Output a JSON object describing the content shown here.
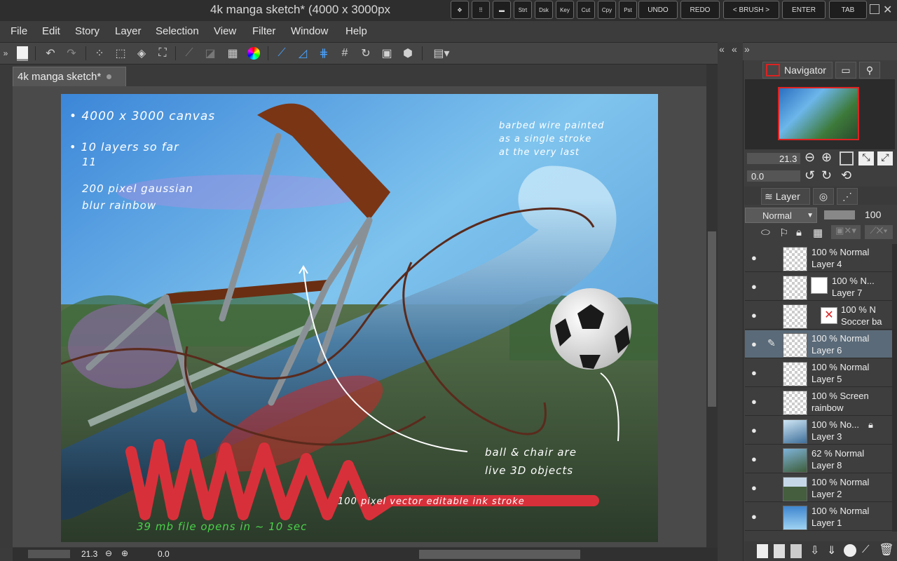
{
  "window": {
    "title": "4k manga sketch* (4000 x 3000px",
    "buttons": [
      "Strt",
      "Dsk",
      "Key",
      "Cut",
      "Cpy",
      "Pst",
      "UNDO",
      "REDO",
      "< BRUSH >",
      "ENTER",
      "TAB"
    ]
  },
  "menu": [
    "File",
    "Edit",
    "Story",
    "Layer",
    "Selection",
    "View",
    "Filter",
    "Window",
    "Help"
  ],
  "document_tab": {
    "label": "4k manga sketch*"
  },
  "canvas_notes": [
    "• 4000 x 3000  canvas",
    "• 10 layers  so far",
    "11",
    "200 pixel gaussian",
    "blur rainbow",
    "barbed wire painted",
    "as a single stroke",
    "at the very last",
    "ball & chair are",
    "live 3D objects",
    "100 pixel vector editable ink stroke",
    "39 mb file opens in ~ 10 sec"
  ],
  "status": {
    "zoom": "21.3",
    "rotation": "0.0"
  },
  "navigator": {
    "tabs": [
      "Navigator"
    ],
    "zoom": "21.3",
    "rotation": "0.0"
  },
  "layer_panel": {
    "tab_label": "Layer",
    "blend_mode": "Normal",
    "opacity": "100",
    "layers": [
      {
        "opacity": "100 %",
        "mode": "Normal",
        "name": "Layer 4"
      },
      {
        "opacity": "100 %",
        "mode": "N...",
        "name": "Layer 7"
      },
      {
        "opacity": "100 %",
        "mode": "N",
        "name": "Soccer ba"
      },
      {
        "opacity": "100 %",
        "mode": "Normal",
        "name": "Layer 6"
      },
      {
        "opacity": "100 %",
        "mode": "Normal",
        "name": "Layer 5"
      },
      {
        "opacity": "100 %",
        "mode": "Screen",
        "name": "rainbow"
      },
      {
        "opacity": "100 %",
        "mode": "No...",
        "name": "Layer 3"
      },
      {
        "opacity": "62 %",
        "mode": "Normal",
        "name": "Layer 8"
      },
      {
        "opacity": "100 %",
        "mode": "Normal",
        "name": "Layer 2"
      },
      {
        "opacity": "100 %",
        "mode": "Normal",
        "name": "Layer 1"
      }
    ]
  },
  "colors": {
    "accent_selected": "#5a6a78",
    "nav_frame": "#dd2222",
    "ink_stroke": "#d8303a",
    "note_green": "#4ad14a"
  }
}
